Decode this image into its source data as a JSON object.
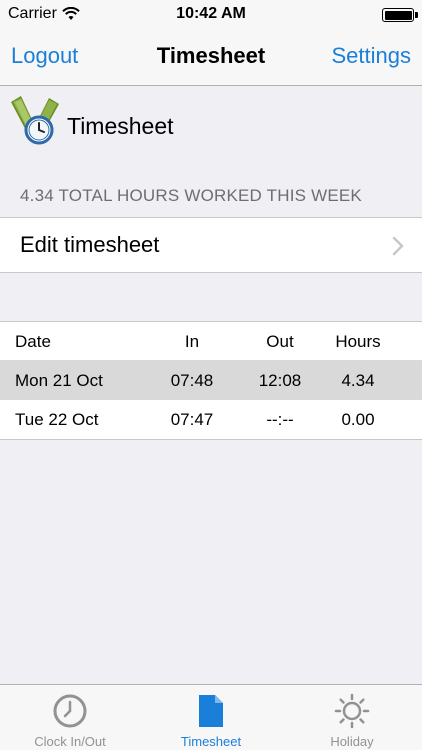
{
  "status_bar": {
    "carrier": "Carrier",
    "time": "10:42 AM"
  },
  "nav": {
    "left": "Logout",
    "title": "Timesheet",
    "right": "Settings"
  },
  "header": {
    "title": "Timesheet"
  },
  "section_label": "4.34 TOTAL HOURS WORKED THIS WEEK",
  "edit_row": {
    "label": "Edit timesheet"
  },
  "table": {
    "columns": [
      "Date",
      "In",
      "Out",
      "Hours"
    ],
    "rows": [
      {
        "date": "Mon 21 Oct",
        "in": "07:48",
        "out": "12:08",
        "hours": "4.34"
      },
      {
        "date": "Tue 22 Oct",
        "in": "07:47",
        "out": "--:--",
        "hours": "0.00"
      }
    ]
  },
  "tabs": [
    {
      "label": "Clock In/Out",
      "icon": "clock-icon"
    },
    {
      "label": "Timesheet",
      "icon": "document-icon"
    },
    {
      "label": "Holiday",
      "icon": "sun-icon"
    }
  ],
  "colors": {
    "accent": "#1a7fd9",
    "inactive": "#929292"
  }
}
